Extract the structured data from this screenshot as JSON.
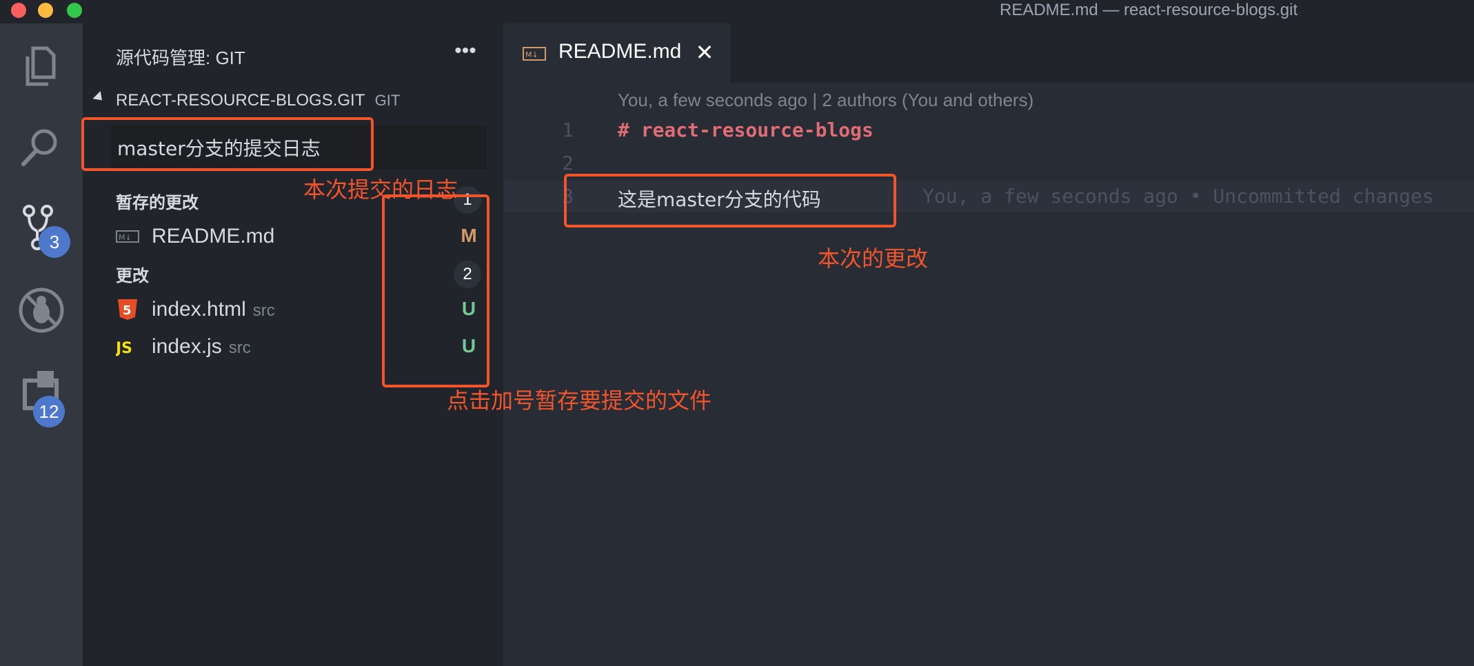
{
  "window": {
    "title": "README.md — react-resource-blogs.git"
  },
  "activity_bar": {
    "items": [
      {
        "name": "explorer",
        "icon": "files-icon"
      },
      {
        "name": "search",
        "icon": "search-icon"
      },
      {
        "name": "source-control",
        "icon": "source-control-icon",
        "badge": "3"
      },
      {
        "name": "debug",
        "icon": "debug-icon"
      },
      {
        "name": "extensions",
        "icon": "extensions-icon",
        "badge": "12"
      }
    ]
  },
  "sidebar": {
    "title": "源代码管理: GIT",
    "more_actions": "•••",
    "repo": {
      "name": "REACT-RESOURCE-BLOGS.GIT",
      "provider": "GIT"
    },
    "commit_message": "master分支的提交日志",
    "staged": {
      "label": "暂存的更改",
      "count": "1",
      "files": [
        {
          "name": "README.md",
          "dir": "",
          "status": "M",
          "status_color": "#d19a66",
          "icon": "markdown-icon"
        }
      ]
    },
    "changes": {
      "label": "更改",
      "count": "2",
      "files": [
        {
          "name": "index.html",
          "dir": "src",
          "status": "U",
          "status_color": "#73c991",
          "icon": "html5-icon"
        },
        {
          "name": "index.js",
          "dir": "src",
          "status": "U",
          "status_color": "#73c991",
          "icon": "js-icon"
        }
      ]
    }
  },
  "editor": {
    "tab": {
      "label": "README.md",
      "close": "✕"
    },
    "blame_header": "You, a few seconds ago | 2 authors (You and others)",
    "lines": [
      {
        "number": "1",
        "text": "# react-resource-blogs"
      },
      {
        "number": "2",
        "text": ""
      },
      {
        "number": "3",
        "text": "这是master分支的代码",
        "blame": "You, a few seconds ago • Uncommitted changes"
      }
    ]
  },
  "annotations": {
    "commit_log": "本次提交的日志",
    "this_change": "本次的更改",
    "stage_hint": "点击加号暂存要提交的文件",
    "color": "#f2552c"
  }
}
